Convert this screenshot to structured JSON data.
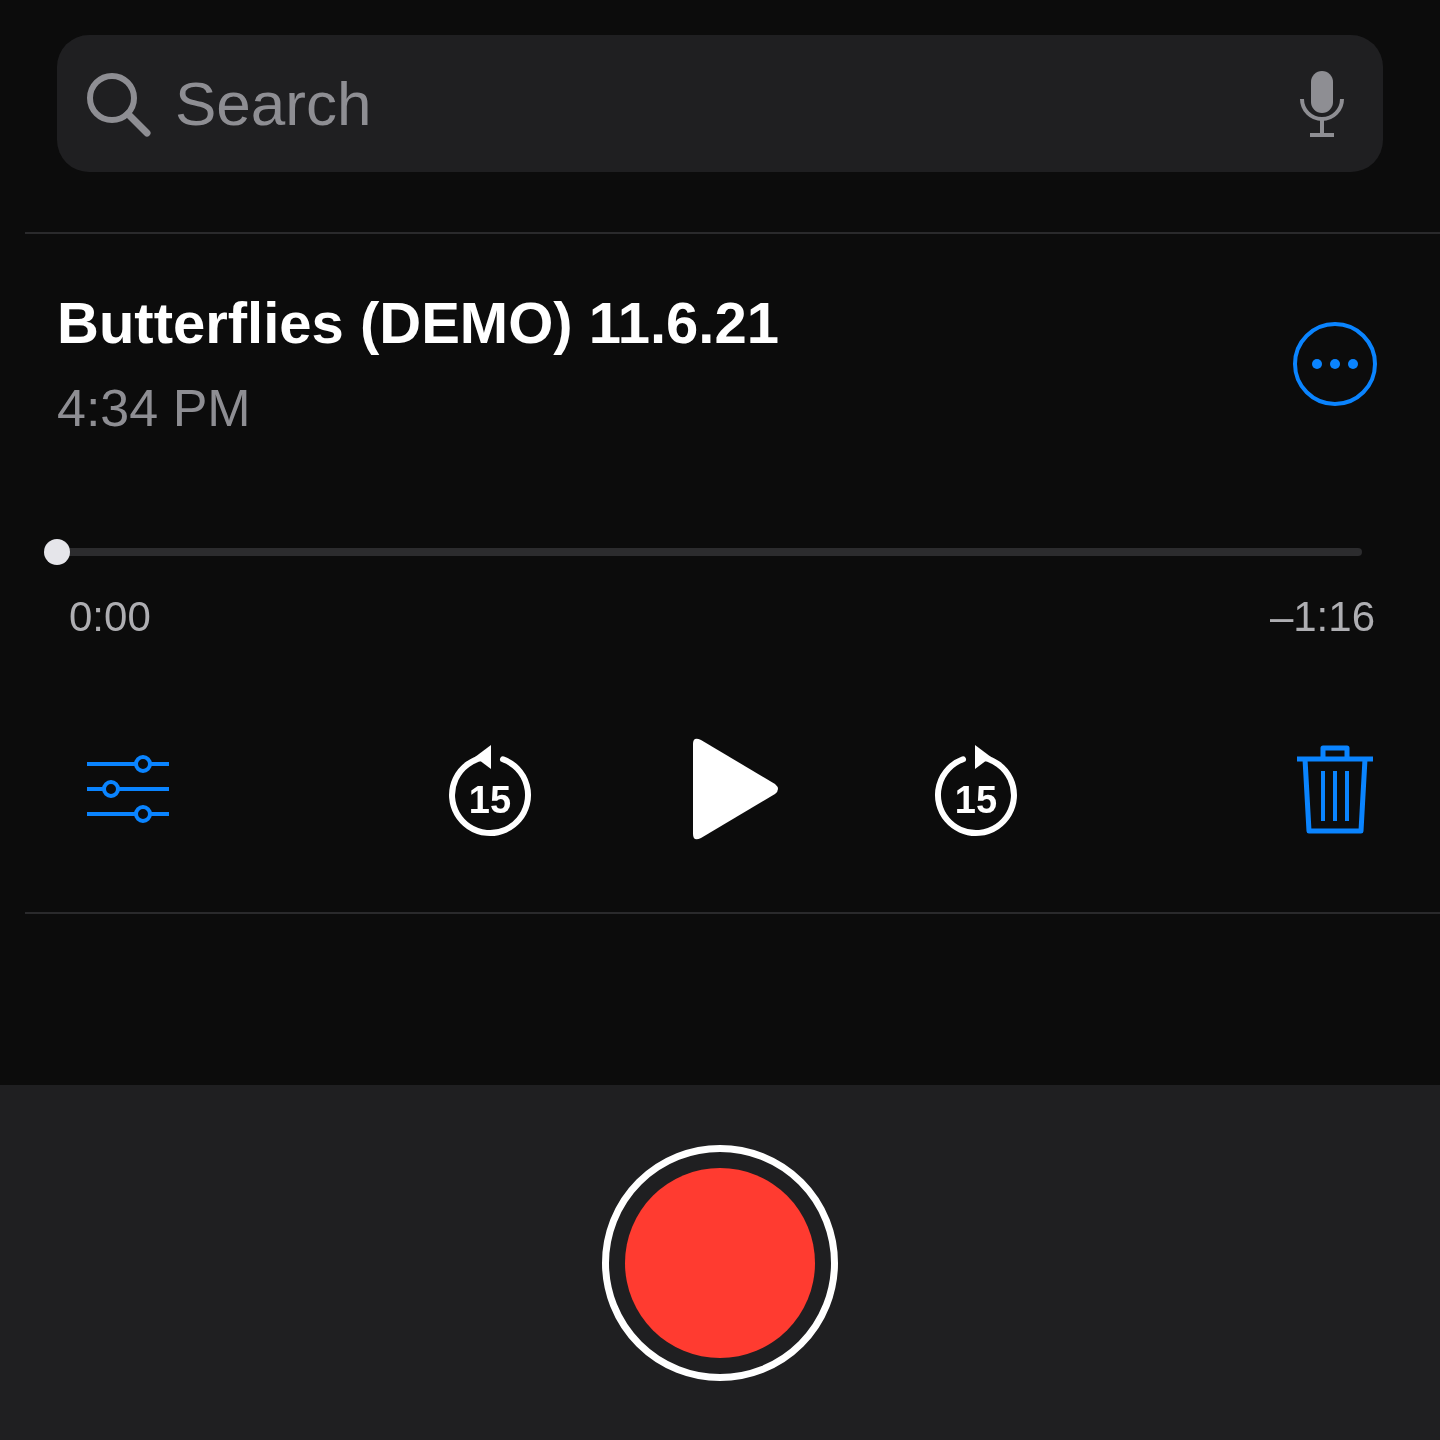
{
  "search": {
    "placeholder": "Search"
  },
  "recording": {
    "title": "Butterflies (DEMO) 11.6.21",
    "time": "4:34 PM"
  },
  "playback": {
    "level": 0,
    "elapsed": "0:00",
    "remaining": "–1:16"
  },
  "controls": {
    "skip_back": "15",
    "skip_forward": "15"
  }
}
